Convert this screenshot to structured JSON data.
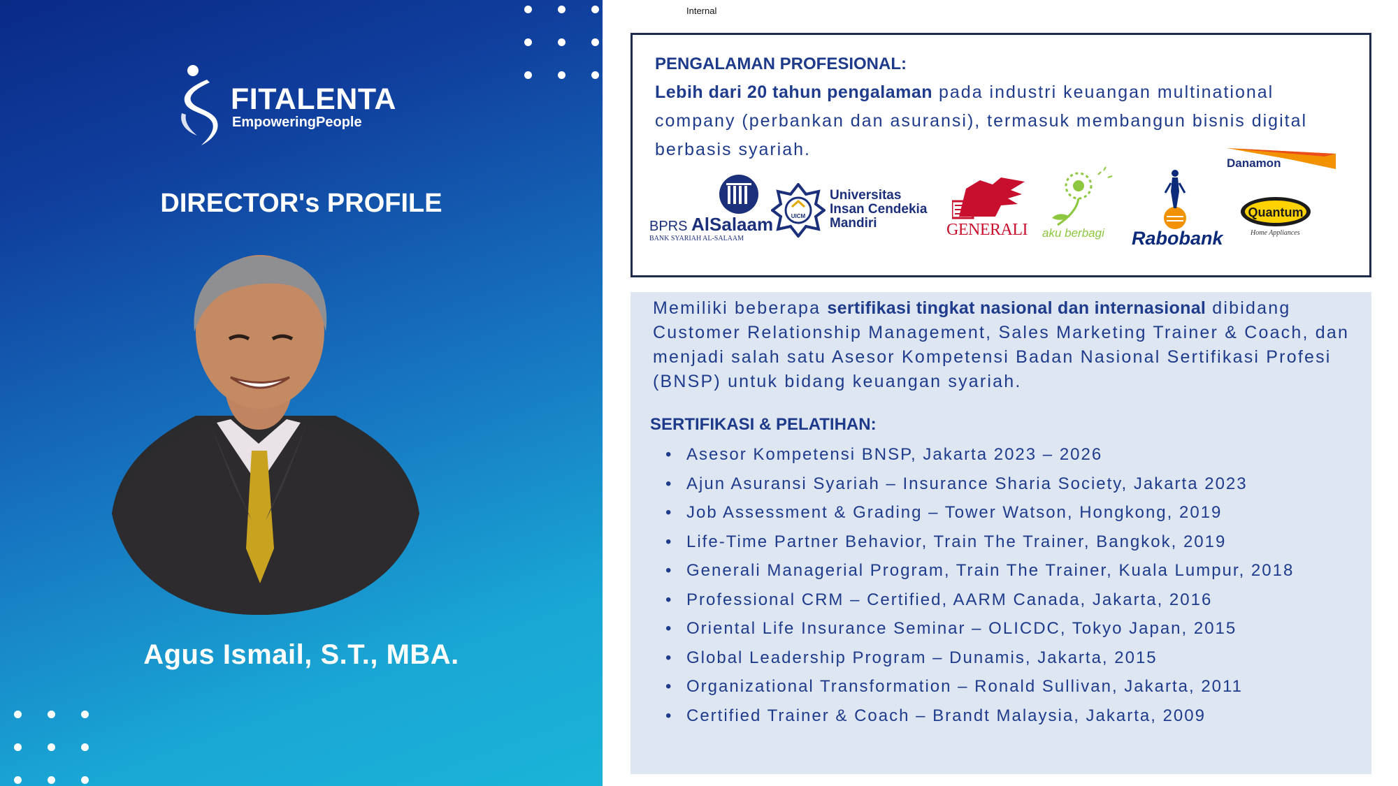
{
  "header": {
    "classification": "Internal"
  },
  "brand": {
    "name": "FITALENTA",
    "tagline": "EmpoweringPeople"
  },
  "profile": {
    "title": "DIRECTOR's PROFILE",
    "name": "Agus Ismail, S.T., MBA."
  },
  "experience": {
    "title": "PENGALAMAN PROFESIONAL:",
    "highlight": "Lebih dari 20 tahun pengalaman",
    "text": " pada industri keuangan multinational company (perbankan dan asuransi), termasuk membangun bisnis digital berbasis syariah."
  },
  "partner_logos": {
    "bprs": {
      "line1_prefix": "BPRS ",
      "line1_brand": "AlSalaam",
      "line2": "BANK SYARIAH AL-SALAAM"
    },
    "uicm": {
      "badge": "UICM",
      "line1": "Universitas",
      "line2": "Insan Cendekia",
      "line3": "Mandiri"
    },
    "generali": {
      "text": "GENERALI"
    },
    "akuberbagi": {
      "text": "aku berbagi"
    },
    "rabobank": {
      "text": "Rabobank"
    },
    "danamon": {
      "text": "Danamon"
    },
    "quantum": {
      "text": "Quantum",
      "sub": "Home Appliances"
    }
  },
  "certification": {
    "intro_before": "Memiliki beberapa ",
    "intro_bold": "sertifikasi tingkat nasional dan internasional",
    "intro_after": " dibidang Customer Relationship Management, Sales Marketing Trainer & Coach, dan menjadi salah satu Asesor Kompetensi Badan Nasional Sertifikasi Profesi (BNSP) untuk bidang keuangan syariah.",
    "title": "SERTIFIKASI & PELATIHAN:",
    "bullet": "•",
    "items": [
      "Asesor Kompetensi BNSP, Jakarta 2023 – 2026",
      "Ajun Asuransi Syariah – Insurance Sharia Society, Jakarta 2023",
      "Job Assessment & Grading – Tower Watson, Hongkong, 2019",
      "Life-Time Partner Behavior, Train The Trainer, Bangkok, 2019",
      "Generali Managerial Program, Train The Trainer, Kuala Lumpur, 2018",
      "Professional CRM – Certified, AARM Canada, Jakarta, 2016",
      "Oriental Life Insurance Seminar – OLICDC, Tokyo Japan, 2015",
      "Global Leadership Program – Dunamis, Jakarta, 2015",
      "Organizational Transformation – Ronald Sullivan, Jakarta, 2011",
      "Certified Trainer & Coach – Brandt Malaysia, Jakarta, 2009"
    ]
  },
  "colors": {
    "accent_dark": "#0a2a86",
    "accent_light": "#1bb4d8",
    "text_blue": "#1f3b8c",
    "cert_bg": "#dde6f1",
    "generali_red": "#c8102e",
    "rabobank_blue": "#0b2a7a",
    "danamon_orange": "#f39200"
  }
}
